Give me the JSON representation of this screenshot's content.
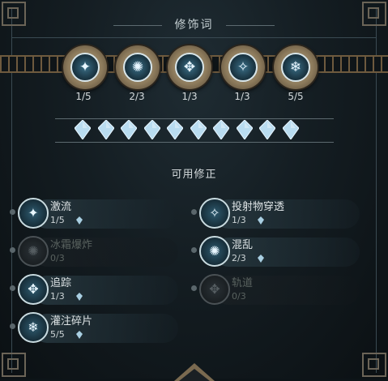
{
  "header": {
    "title": "修饰词"
  },
  "slots": [
    {
      "icon": "shard-burst-icon",
      "glyph": "✦",
      "count": "1/5"
    },
    {
      "icon": "frost-nova-icon",
      "glyph": "✺",
      "count": "2/3"
    },
    {
      "icon": "compass-tracking-icon",
      "glyph": "✥",
      "count": "1/3"
    },
    {
      "icon": "split-projectile-icon",
      "glyph": "✧",
      "count": "1/3"
    },
    {
      "icon": "snowflake-icon",
      "glyph": "❄",
      "count": "5/5"
    }
  ],
  "gems": {
    "count": 10,
    "color": "#b9dcf0"
  },
  "available_title": "可用修正",
  "modifiers": [
    {
      "name": "激流",
      "count": "1/5",
      "icon": "torrent-icon",
      "glyph": "✦",
      "enabled": true
    },
    {
      "name": "投射物穿透",
      "count": "1/3",
      "icon": "projectile-pierce-icon",
      "glyph": "✧",
      "enabled": true
    },
    {
      "name": "冰霜爆炸",
      "count": "0/3",
      "icon": "frost-explosion-icon",
      "glyph": "✺",
      "enabled": false
    },
    {
      "name": "混乱",
      "count": "2/3",
      "icon": "chaos-icon",
      "glyph": "✺",
      "enabled": true
    },
    {
      "name": "追踪",
      "count": "1/3",
      "icon": "tracking-icon",
      "glyph": "✥",
      "enabled": true
    },
    {
      "name": "轨道",
      "count": "0/3",
      "icon": "orbit-icon",
      "glyph": "✥",
      "enabled": false
    },
    {
      "name": "灌注碎片",
      "count": "5/5",
      "icon": "infused-shards-icon",
      "glyph": "❄",
      "enabled": true
    }
  ],
  "colors": {
    "gold": "#8d7b5c",
    "ice": "#b9dcf0",
    "accent": "#3a6e86"
  }
}
